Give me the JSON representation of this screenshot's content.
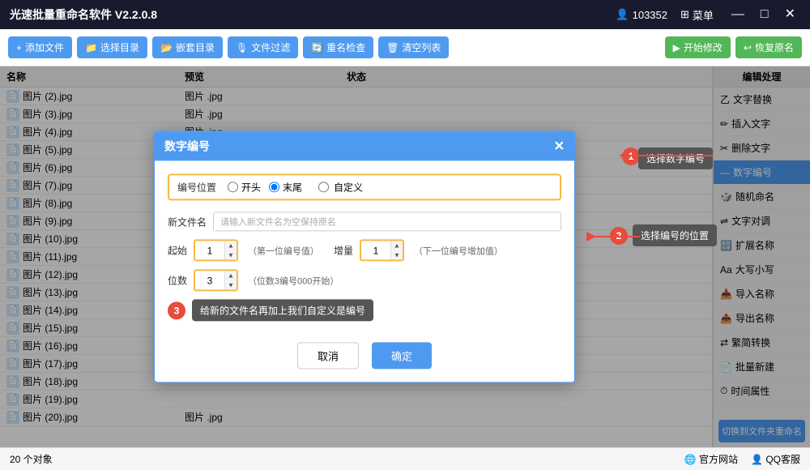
{
  "titleBar": {
    "title": "光速批量重命名软件 V2.2.0.8",
    "userId": "103352",
    "menuLabel": "菜单",
    "controls": [
      "—",
      "□",
      "✕"
    ]
  },
  "toolbar": {
    "buttons": [
      {
        "label": "添加文件",
        "icon": "+"
      },
      {
        "label": "选择目录",
        "icon": "📁"
      },
      {
        "label": "嵌套目录",
        "icon": "📂"
      },
      {
        "label": "文件过滤",
        "icon": "🎤"
      },
      {
        "label": "重名检查",
        "icon": "🔄"
      },
      {
        "label": "清空列表",
        "icon": "🗑"
      }
    ],
    "rightButtons": [
      {
        "label": "开始修改",
        "icon": "▶"
      },
      {
        "label": "恢复原名",
        "icon": "↩"
      }
    ]
  },
  "listHeader": {
    "name": "名称",
    "preview": "预览",
    "status": "状态"
  },
  "files": [
    {
      "name": "图片 (2).jpg",
      "preview": "图片 .jpg",
      "status": ""
    },
    {
      "name": "图片 (3).jpg",
      "preview": "图片 .jpg",
      "status": ""
    },
    {
      "name": "图片 (4).jpg",
      "preview": "图片 .jpg",
      "status": ""
    },
    {
      "name": "图片 (5).jpg",
      "preview": "",
      "status": ""
    },
    {
      "name": "图片 (6).jpg",
      "preview": "",
      "status": ""
    },
    {
      "name": "图片 (7).jpg",
      "preview": "",
      "status": ""
    },
    {
      "name": "图片 (8).jpg",
      "preview": "",
      "status": ""
    },
    {
      "name": "图片 (9).jpg",
      "preview": "",
      "status": ""
    },
    {
      "name": "图片 (10).jpg",
      "preview": "",
      "status": ""
    },
    {
      "name": "图片 (11).jpg",
      "preview": "",
      "status": ""
    },
    {
      "name": "图片 (12).jpg",
      "preview": "",
      "status": ""
    },
    {
      "name": "图片 (13).jpg",
      "preview": "",
      "status": ""
    },
    {
      "name": "图片 (14).jpg",
      "preview": "",
      "status": ""
    },
    {
      "name": "图片 (15).jpg",
      "preview": "",
      "status": ""
    },
    {
      "name": "图片 (16).jpg",
      "preview": "",
      "status": ""
    },
    {
      "name": "图片 (17).jpg",
      "preview": "",
      "status": ""
    },
    {
      "name": "图片 (18).jpg",
      "preview": "",
      "status": ""
    },
    {
      "name": "图片 (19).jpg",
      "preview": "",
      "status": ""
    },
    {
      "name": "图片 (20).jpg",
      "preview": "图片 .jpg",
      "status": ""
    }
  ],
  "rightPanel": {
    "title": "编辑处理",
    "items": [
      {
        "label": "文字替换",
        "icon": "乙",
        "active": false
      },
      {
        "label": "插入文字",
        "icon": "📝",
        "active": false
      },
      {
        "label": "删除文字",
        "icon": "📄",
        "active": false
      },
      {
        "label": "数字编号",
        "icon": "—",
        "active": true
      },
      {
        "label": "随机命名",
        "icon": "✕",
        "active": false
      },
      {
        "label": "文字对调",
        "icon": "⇌",
        "active": false
      },
      {
        "label": "扩展名称",
        "icon": "📋",
        "active": false
      },
      {
        "label": "大写小写",
        "icon": "A",
        "active": false
      },
      {
        "label": "导入名称",
        "icon": "📥",
        "active": false
      },
      {
        "label": "导出名称",
        "icon": "📤",
        "active": false
      },
      {
        "label": "繁简转换",
        "icon": "⇄",
        "active": false
      },
      {
        "label": "批量新建",
        "icon": "📄",
        "active": false
      },
      {
        "label": "时间属性",
        "icon": "⏱",
        "active": false
      }
    ],
    "switchBtn": "切换到文件夹重命名"
  },
  "dialog": {
    "title": "数字编号",
    "closeIcon": "✕",
    "positionLabel": "编号位置",
    "radioOptions": [
      {
        "label": "开头",
        "value": "start",
        "checked": false
      },
      {
        "label": "末尾",
        "value": "end",
        "checked": true
      }
    ],
    "customLabel": "自定义",
    "newFileLabel": "新文件名",
    "newFilePlaceholder": "请输入新文件名为空保持原名",
    "startLabel": "起始",
    "startValue": "1",
    "startHint": "（第一位编号值）",
    "incrementLabel": "增量",
    "incrementValue": "1",
    "incrementHint": "（下一位编号增加值）",
    "digitsLabel": "位数",
    "digitsValue": "3",
    "digitsHint": "（位数3编号000开始）",
    "cancelBtn": "取消",
    "confirmBtn": "确定"
  },
  "annotations": [
    {
      "number": "1",
      "text": "选择数字编号"
    },
    {
      "number": "2",
      "text": "选择编号的位置"
    },
    {
      "number": "3",
      "text": "给新的文件名再加上我们自定义是编号"
    }
  ],
  "statusBar": {
    "count": "20 个对象",
    "website": "官方网站",
    "qq": "QQ客服"
  }
}
